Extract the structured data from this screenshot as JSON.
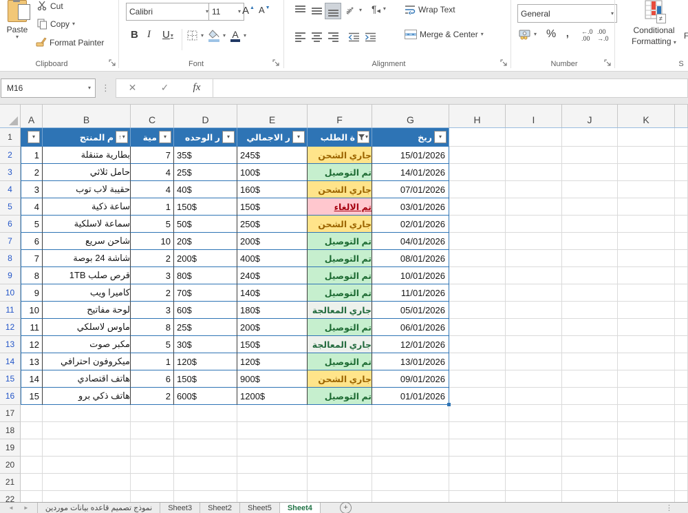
{
  "ribbon": {
    "clipboard": {
      "paste": "Paste",
      "cut": "Cut",
      "copy": "Copy",
      "format_painter": "Format Painter",
      "group_label": "Clipboard"
    },
    "font": {
      "font_name": "Calibri",
      "font_size": "11",
      "bold": "B",
      "italic": "I",
      "underline": "U",
      "group_label": "Font"
    },
    "alignment": {
      "wrap_text": "Wrap Text",
      "merge_center": "Merge & Center",
      "group_label": "Alignment"
    },
    "number": {
      "format": "General",
      "percent": "%",
      "comma": ",",
      "group_label": "Number"
    },
    "styles": {
      "cf_line1": "Conditional",
      "cf_line2": "Formatting",
      "partial_next": "F",
      "partial_group": "S"
    }
  },
  "formula_bar": {
    "name_box": "M16",
    "cancel": "✕",
    "enter": "✓",
    "fx": "fx",
    "formula_value": ""
  },
  "grid": {
    "column_letters": [
      "",
      "A",
      "B",
      "C",
      "D",
      "E",
      "F",
      "G",
      "H",
      "I",
      "J",
      "K",
      ""
    ],
    "first_row": 1,
    "last_row": 22,
    "filtered_row_numbers": "2-16",
    "headers": [
      {
        "col": "A",
        "label": "",
        "icon": "dropdown"
      },
      {
        "col": "B",
        "label": "م المنتج",
        "icon": "sort-asc"
      },
      {
        "col": "C",
        "label": "مية",
        "icon": "dropdown"
      },
      {
        "col": "D",
        "label": "ر الوحده",
        "icon": "dropdown"
      },
      {
        "col": "E",
        "label": "ر الاجمالي",
        "icon": "dropdown"
      },
      {
        "col": "F",
        "label": "ة الطلب",
        "icon": "filter"
      },
      {
        "col": "G",
        "label": "ريخ",
        "icon": "dropdown"
      }
    ],
    "rows": [
      {
        "n": "1",
        "product": "بطارية متنقلة",
        "qty": "7",
        "unit": "35$",
        "total": "245$",
        "status": "shipping",
        "date": "15/01/2026"
      },
      {
        "n": "2",
        "product": "حامل ثلاثي",
        "qty": "4",
        "unit": "25$",
        "total": "100$",
        "status": "delivered",
        "date": "14/01/2026"
      },
      {
        "n": "3",
        "product": "حقيبة لاب توب",
        "qty": "4",
        "unit": "40$",
        "total": "160$",
        "status": "shipping",
        "date": "07/01/2026"
      },
      {
        "n": "4",
        "product": "ساعة ذكية",
        "qty": "1",
        "unit": "150$",
        "total": "150$",
        "status": "cancelled",
        "date": "03/01/2026"
      },
      {
        "n": "5",
        "product": "سماعة لاسلكية",
        "qty": "5",
        "unit": "50$",
        "total": "250$",
        "status": "shipping",
        "date": "02/01/2026"
      },
      {
        "n": "6",
        "product": "شاحن سريع",
        "qty": "10",
        "unit": "20$",
        "total": "200$",
        "status": "delivered",
        "date": "04/01/2026"
      },
      {
        "n": "7",
        "product": "شاشة 24 بوصة",
        "qty": "2",
        "unit": "200$",
        "total": "400$",
        "status": "delivered",
        "date": "08/01/2026"
      },
      {
        "n": "8",
        "product": "قرص صلب 1TB",
        "qty": "3",
        "unit": "80$",
        "total": "240$",
        "status": "delivered",
        "date": "10/01/2026"
      },
      {
        "n": "9",
        "product": "كاميرا ويب",
        "qty": "2",
        "unit": "70$",
        "total": "140$",
        "status": "delivered",
        "date": "11/01/2026"
      },
      {
        "n": "10",
        "product": "لوحة مفاتيح",
        "qty": "3",
        "unit": "60$",
        "total": "180$",
        "status": "processing",
        "date": "05/01/2026"
      },
      {
        "n": "11",
        "product": "ماوس لاسلكي",
        "qty": "8",
        "unit": "25$",
        "total": "200$",
        "status": "delivered",
        "date": "06/01/2026"
      },
      {
        "n": "12",
        "product": "مكبر صوت",
        "qty": "5",
        "unit": "30$",
        "total": "150$",
        "status": "processing",
        "date": "12/01/2026"
      },
      {
        "n": "13",
        "product": "ميكروفون احترافي",
        "qty": "1",
        "unit": "120$",
        "total": "120$",
        "status": "delivered",
        "date": "13/01/2026"
      },
      {
        "n": "14",
        "product": "هاتف اقتصادي",
        "qty": "6",
        "unit": "150$",
        "total": "900$",
        "status": "shipping",
        "date": "09/01/2026"
      },
      {
        "n": "15",
        "product": "هاتف ذكي برو",
        "qty": "2",
        "unit": "600$",
        "total": "1200$",
        "status": "delivered",
        "date": "01/01/2026"
      }
    ],
    "status_styles": {
      "shipping": {
        "label": "جاري الشحن",
        "bg": "#FFE48A",
        "fg": "#9C6500",
        "underline": false
      },
      "delivered": {
        "label": "تم التوصيل",
        "bg": "#C6EFCE",
        "fg": "#1E6B33",
        "underline": false
      },
      "cancelled": {
        "label": "تم الالغاء",
        "bg": "#FFC7CE",
        "fg": "#A50010",
        "underline": true
      },
      "processing": {
        "label": "جاري المعالجة",
        "bg": "#EDF1EC",
        "fg": "#246B3F",
        "underline": false
      }
    },
    "table_colors": {
      "header_bg": "#2E74B5",
      "row_border": "#2E74B5",
      "filtered_row_number": "#2456C8"
    }
  },
  "sheet_tabs": {
    "tabs": [
      "نموذج تصميم قاعده بيانات موردين",
      "Sheet3",
      "Sheet2",
      "Sheet5",
      "Sheet4"
    ],
    "active": "Sheet4",
    "active_color": "#217346",
    "add_sheet": "+"
  }
}
